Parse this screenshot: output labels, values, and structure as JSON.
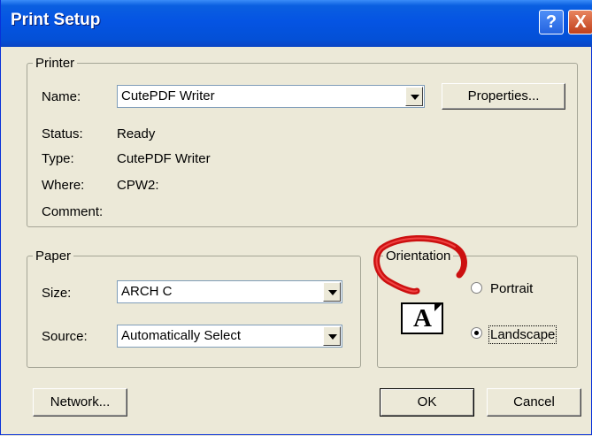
{
  "window": {
    "title": "Print Setup",
    "help_glyph": "?",
    "close_glyph": "X"
  },
  "printer": {
    "legend": "Printer",
    "name_label": "Name:",
    "name_value": "CutePDF Writer",
    "properties_label": "Properties...",
    "status_label": "Status:",
    "status_value": "Ready",
    "type_label": "Type:",
    "type_value": "CutePDF Writer",
    "where_label": "Where:",
    "where_value": "CPW2:",
    "comment_label": "Comment:",
    "comment_value": ""
  },
  "paper": {
    "legend": "Paper",
    "size_label": "Size:",
    "size_value": "ARCH C",
    "source_label": "Source:",
    "source_value": "Automatically Select"
  },
  "orientation": {
    "legend": "Orientation",
    "portrait_label": "Portrait",
    "landscape_label": "Landscape",
    "selected": "Landscape",
    "icon_letter": "A"
  },
  "buttons": {
    "network": "Network...",
    "ok": "OK",
    "cancel": "Cancel"
  },
  "colors": {
    "titlebar": "#0554e3",
    "face": "#ece9d8",
    "annotation": "#cc1010"
  },
  "icons": {
    "help": "help-icon",
    "close": "close-icon",
    "dropdown": "chevron-down-icon"
  }
}
